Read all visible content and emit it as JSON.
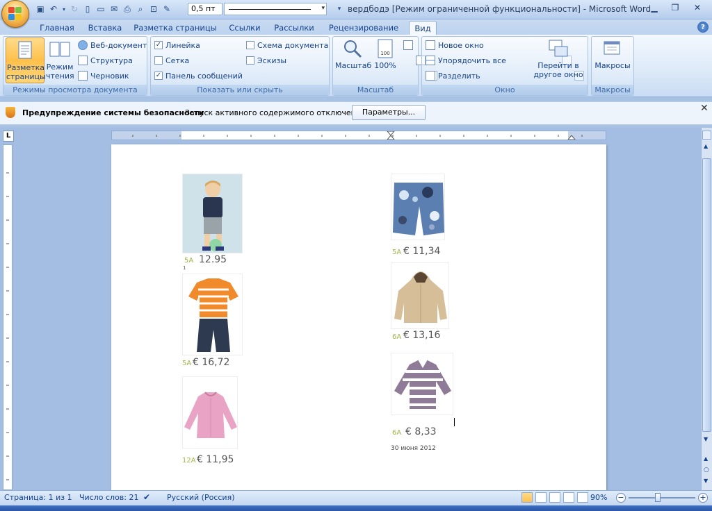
{
  "window": {
    "title": "вердбодэ [Режим ограниченной функциональности] - Microsoft Word",
    "font_size": "0,5 пт"
  },
  "tabs": [
    {
      "label": "Главная",
      "active": false
    },
    {
      "label": "Вставка",
      "active": false
    },
    {
      "label": "Разметка страницы",
      "active": false
    },
    {
      "label": "Ссылки",
      "active": false
    },
    {
      "label": "Рассылки",
      "active": false
    },
    {
      "label": "Рецензирование",
      "active": false
    },
    {
      "label": "Вид",
      "active": true
    }
  ],
  "ribbon": {
    "views": {
      "label": "Режимы просмотра документа",
      "page_layout": "Разметка страницы",
      "reading": "Режим чтения",
      "web": "Веб-документ",
      "outline": "Структура",
      "draft": "Черновик"
    },
    "show": {
      "label": "Показать или скрыть",
      "ruler": "Линейка",
      "grid": "Сетка",
      "message_bar": "Панель сообщений",
      "doc_map": "Схема документа",
      "thumbnails": "Эскизы"
    },
    "zoom": {
      "label": "Масштаб",
      "zoom_btn": "Масштаб",
      "percent_btn": "100%"
    },
    "window_group": {
      "label": "Окно",
      "new_window": "Новое окно",
      "arrange": "Упорядочить все",
      "split": "Разделить",
      "switch_line1": "Перейти в",
      "switch_line2": "другое окно"
    },
    "macros": {
      "label": "Макросы",
      "btn": "Макросы"
    }
  },
  "security_bar": {
    "title": "Предупреждение системы безопасности",
    "message": "Запуск активного содержимого отключен.",
    "button": "Параметры..."
  },
  "document": {
    "products": [
      {
        "size": "5А",
        "price": "12.95"
      },
      {
        "size": "5А",
        "price": "€ 16,72"
      },
      {
        "size": "12А",
        "price": "€ 11,95"
      },
      {
        "size": "5А",
        "price": "€ 11,34"
      },
      {
        "size": "6А",
        "price": "€ 13,16"
      },
      {
        "size": "6А",
        "price": "€ 8,33"
      }
    ],
    "date": "30 июня 2012",
    "small_mark": "1"
  },
  "status": {
    "page": "Страница: 1 из 1",
    "words": "Число слов: 21",
    "language": "Русский (Россия)",
    "zoom": "90%"
  }
}
